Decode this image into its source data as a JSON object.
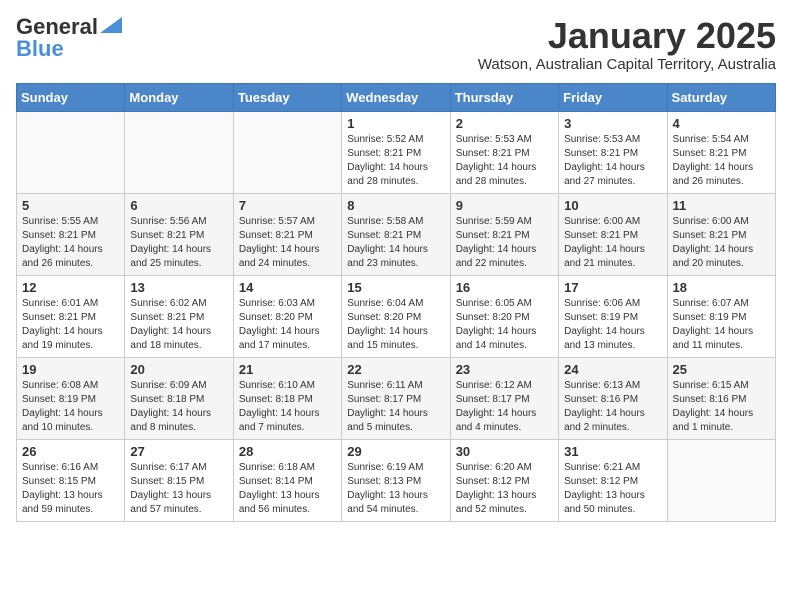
{
  "header": {
    "logo_general": "General",
    "logo_blue": "Blue",
    "month": "January 2025",
    "location": "Watson, Australian Capital Territory, Australia"
  },
  "weekdays": [
    "Sunday",
    "Monday",
    "Tuesday",
    "Wednesday",
    "Thursday",
    "Friday",
    "Saturday"
  ],
  "weeks": [
    [
      {
        "day": "",
        "info": ""
      },
      {
        "day": "",
        "info": ""
      },
      {
        "day": "",
        "info": ""
      },
      {
        "day": "1",
        "info": "Sunrise: 5:52 AM\nSunset: 8:21 PM\nDaylight: 14 hours\nand 28 minutes."
      },
      {
        "day": "2",
        "info": "Sunrise: 5:53 AM\nSunset: 8:21 PM\nDaylight: 14 hours\nand 28 minutes."
      },
      {
        "day": "3",
        "info": "Sunrise: 5:53 AM\nSunset: 8:21 PM\nDaylight: 14 hours\nand 27 minutes."
      },
      {
        "day": "4",
        "info": "Sunrise: 5:54 AM\nSunset: 8:21 PM\nDaylight: 14 hours\nand 26 minutes."
      }
    ],
    [
      {
        "day": "5",
        "info": "Sunrise: 5:55 AM\nSunset: 8:21 PM\nDaylight: 14 hours\nand 26 minutes."
      },
      {
        "day": "6",
        "info": "Sunrise: 5:56 AM\nSunset: 8:21 PM\nDaylight: 14 hours\nand 25 minutes."
      },
      {
        "day": "7",
        "info": "Sunrise: 5:57 AM\nSunset: 8:21 PM\nDaylight: 14 hours\nand 24 minutes."
      },
      {
        "day": "8",
        "info": "Sunrise: 5:58 AM\nSunset: 8:21 PM\nDaylight: 14 hours\nand 23 minutes."
      },
      {
        "day": "9",
        "info": "Sunrise: 5:59 AM\nSunset: 8:21 PM\nDaylight: 14 hours\nand 22 minutes."
      },
      {
        "day": "10",
        "info": "Sunrise: 6:00 AM\nSunset: 8:21 PM\nDaylight: 14 hours\nand 21 minutes."
      },
      {
        "day": "11",
        "info": "Sunrise: 6:00 AM\nSunset: 8:21 PM\nDaylight: 14 hours\nand 20 minutes."
      }
    ],
    [
      {
        "day": "12",
        "info": "Sunrise: 6:01 AM\nSunset: 8:21 PM\nDaylight: 14 hours\nand 19 minutes."
      },
      {
        "day": "13",
        "info": "Sunrise: 6:02 AM\nSunset: 8:21 PM\nDaylight: 14 hours\nand 18 minutes."
      },
      {
        "day": "14",
        "info": "Sunrise: 6:03 AM\nSunset: 8:20 PM\nDaylight: 14 hours\nand 17 minutes."
      },
      {
        "day": "15",
        "info": "Sunrise: 6:04 AM\nSunset: 8:20 PM\nDaylight: 14 hours\nand 15 minutes."
      },
      {
        "day": "16",
        "info": "Sunrise: 6:05 AM\nSunset: 8:20 PM\nDaylight: 14 hours\nand 14 minutes."
      },
      {
        "day": "17",
        "info": "Sunrise: 6:06 AM\nSunset: 8:19 PM\nDaylight: 14 hours\nand 13 minutes."
      },
      {
        "day": "18",
        "info": "Sunrise: 6:07 AM\nSunset: 8:19 PM\nDaylight: 14 hours\nand 11 minutes."
      }
    ],
    [
      {
        "day": "19",
        "info": "Sunrise: 6:08 AM\nSunset: 8:19 PM\nDaylight: 14 hours\nand 10 minutes."
      },
      {
        "day": "20",
        "info": "Sunrise: 6:09 AM\nSunset: 8:18 PM\nDaylight: 14 hours\nand 8 minutes."
      },
      {
        "day": "21",
        "info": "Sunrise: 6:10 AM\nSunset: 8:18 PM\nDaylight: 14 hours\nand 7 minutes."
      },
      {
        "day": "22",
        "info": "Sunrise: 6:11 AM\nSunset: 8:17 PM\nDaylight: 14 hours\nand 5 minutes."
      },
      {
        "day": "23",
        "info": "Sunrise: 6:12 AM\nSunset: 8:17 PM\nDaylight: 14 hours\nand 4 minutes."
      },
      {
        "day": "24",
        "info": "Sunrise: 6:13 AM\nSunset: 8:16 PM\nDaylight: 14 hours\nand 2 minutes."
      },
      {
        "day": "25",
        "info": "Sunrise: 6:15 AM\nSunset: 8:16 PM\nDaylight: 14 hours\nand 1 minute."
      }
    ],
    [
      {
        "day": "26",
        "info": "Sunrise: 6:16 AM\nSunset: 8:15 PM\nDaylight: 13 hours\nand 59 minutes."
      },
      {
        "day": "27",
        "info": "Sunrise: 6:17 AM\nSunset: 8:15 PM\nDaylight: 13 hours\nand 57 minutes."
      },
      {
        "day": "28",
        "info": "Sunrise: 6:18 AM\nSunset: 8:14 PM\nDaylight: 13 hours\nand 56 minutes."
      },
      {
        "day": "29",
        "info": "Sunrise: 6:19 AM\nSunset: 8:13 PM\nDaylight: 13 hours\nand 54 minutes."
      },
      {
        "day": "30",
        "info": "Sunrise: 6:20 AM\nSunset: 8:12 PM\nDaylight: 13 hours\nand 52 minutes."
      },
      {
        "day": "31",
        "info": "Sunrise: 6:21 AM\nSunset: 8:12 PM\nDaylight: 13 hours\nand 50 minutes."
      },
      {
        "day": "",
        "info": ""
      }
    ]
  ]
}
